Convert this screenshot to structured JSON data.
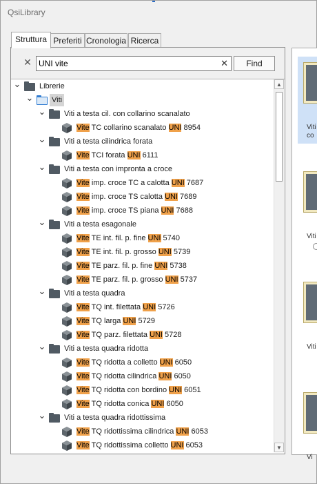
{
  "app": {
    "title": "QsiLibrary"
  },
  "tabs": [
    {
      "label": "Struttura",
      "active": true
    },
    {
      "label": "Preferiti",
      "active": false
    },
    {
      "label": "Cronologia",
      "active": false
    },
    {
      "label": "Ricerca",
      "active": false
    }
  ],
  "search": {
    "value": "UNI vite",
    "find_label": "Find"
  },
  "colors": {
    "highlight": "#f0a14a",
    "selected_row": "#d5d5d5",
    "folder": "#505a63",
    "folder_blue": "#2f7bd1"
  },
  "tree": [
    {
      "depth": 0,
      "type": "folder",
      "expanded": true,
      "parts": [
        {
          "t": "Librerie",
          "h": false
        }
      ]
    },
    {
      "depth": 1,
      "type": "folder-blue",
      "expanded": true,
      "selected": true,
      "parts": [
        {
          "t": "Viti",
          "h": false
        }
      ]
    },
    {
      "depth": 2,
      "type": "folder",
      "expanded": true,
      "parts": [
        {
          "t": "Viti a testa cil. con collarino scanalato",
          "h": false
        }
      ]
    },
    {
      "depth": 3,
      "type": "part",
      "parts": [
        {
          "t": "Vite",
          "h": true
        },
        {
          "t": " TC collarino scanalato ",
          "h": false
        },
        {
          "t": "UNI",
          "h": true
        },
        {
          "t": " 8954",
          "h": false
        }
      ]
    },
    {
      "depth": 2,
      "type": "folder",
      "expanded": true,
      "parts": [
        {
          "t": "Viti a testa cilindrica forata",
          "h": false
        }
      ]
    },
    {
      "depth": 3,
      "type": "part",
      "parts": [
        {
          "t": "Vite",
          "h": true
        },
        {
          "t": " TCI forata ",
          "h": false
        },
        {
          "t": "UNI",
          "h": true
        },
        {
          "t": " 6111",
          "h": false
        }
      ]
    },
    {
      "depth": 2,
      "type": "folder",
      "expanded": true,
      "parts": [
        {
          "t": "Viti a testa con impronta a croce",
          "h": false
        }
      ]
    },
    {
      "depth": 3,
      "type": "part",
      "parts": [
        {
          "t": "Vite",
          "h": true
        },
        {
          "t": " imp. croce TC a calotta ",
          "h": false
        },
        {
          "t": "UNI",
          "h": true
        },
        {
          "t": " 7687",
          "h": false
        }
      ]
    },
    {
      "depth": 3,
      "type": "part",
      "parts": [
        {
          "t": "Vite",
          "h": true
        },
        {
          "t": " imp. croce TS calotta ",
          "h": false
        },
        {
          "t": "UNI",
          "h": true
        },
        {
          "t": " 7689",
          "h": false
        }
      ]
    },
    {
      "depth": 3,
      "type": "part",
      "parts": [
        {
          "t": "Vite",
          "h": true
        },
        {
          "t": " imp. croce TS piana ",
          "h": false
        },
        {
          "t": "UNI",
          "h": true
        },
        {
          "t": " 7688",
          "h": false
        }
      ]
    },
    {
      "depth": 2,
      "type": "folder",
      "expanded": true,
      "parts": [
        {
          "t": "Viti a testa esagonale",
          "h": false
        }
      ]
    },
    {
      "depth": 3,
      "type": "part",
      "parts": [
        {
          "t": "Vite",
          "h": true
        },
        {
          "t": " TE int. fil. p. fine ",
          "h": false
        },
        {
          "t": "UNI",
          "h": true
        },
        {
          "t": " 5740",
          "h": false
        }
      ]
    },
    {
      "depth": 3,
      "type": "part",
      "parts": [
        {
          "t": "Vite",
          "h": true
        },
        {
          "t": " TE int. fil. p. grosso ",
          "h": false
        },
        {
          "t": "UNI",
          "h": true
        },
        {
          "t": " 5739",
          "h": false
        }
      ]
    },
    {
      "depth": 3,
      "type": "part",
      "parts": [
        {
          "t": "Vite",
          "h": true
        },
        {
          "t": " TE parz. fil. p. fine ",
          "h": false
        },
        {
          "t": "UNI",
          "h": true
        },
        {
          "t": " 5738",
          "h": false
        }
      ]
    },
    {
      "depth": 3,
      "type": "part",
      "parts": [
        {
          "t": "Vite",
          "h": true
        },
        {
          "t": " TE parz. fil. p. grosso ",
          "h": false
        },
        {
          "t": "UNI",
          "h": true
        },
        {
          "t": " 5737",
          "h": false
        }
      ]
    },
    {
      "depth": 2,
      "type": "folder",
      "expanded": true,
      "parts": [
        {
          "t": "Viti a testa quadra",
          "h": false
        }
      ]
    },
    {
      "depth": 3,
      "type": "part",
      "parts": [
        {
          "t": "Vite",
          "h": true
        },
        {
          "t": " TQ int. filettata ",
          "h": false
        },
        {
          "t": "UNI",
          "h": true
        },
        {
          "t": " 5726",
          "h": false
        }
      ]
    },
    {
      "depth": 3,
      "type": "part",
      "parts": [
        {
          "t": "Vite",
          "h": true
        },
        {
          "t": " TQ larga ",
          "h": false
        },
        {
          "t": "UNI",
          "h": true
        },
        {
          "t": " 5729",
          "h": false
        }
      ]
    },
    {
      "depth": 3,
      "type": "part",
      "parts": [
        {
          "t": "Vite",
          "h": true
        },
        {
          "t": " TQ parz. filettata ",
          "h": false
        },
        {
          "t": "UNI",
          "h": true
        },
        {
          "t": " 5728",
          "h": false
        }
      ]
    },
    {
      "depth": 2,
      "type": "folder",
      "expanded": true,
      "parts": [
        {
          "t": "Viti a testa quadra ridotta",
          "h": false
        }
      ]
    },
    {
      "depth": 3,
      "type": "part",
      "parts": [
        {
          "t": "Vite",
          "h": true
        },
        {
          "t": " TQ ridotta a colletto ",
          "h": false
        },
        {
          "t": "UNI",
          "h": true
        },
        {
          "t": " 6050",
          "h": false
        }
      ]
    },
    {
      "depth": 3,
      "type": "part",
      "parts": [
        {
          "t": "Vite",
          "h": true
        },
        {
          "t": " TQ ridotta cilindrica ",
          "h": false
        },
        {
          "t": "UNI",
          "h": true
        },
        {
          "t": " 6050",
          "h": false
        }
      ]
    },
    {
      "depth": 3,
      "type": "part",
      "parts": [
        {
          "t": "Vite",
          "h": true
        },
        {
          "t": " TQ ridotta con bordino ",
          "h": false
        },
        {
          "t": "UNI",
          "h": true
        },
        {
          "t": " 6051",
          "h": false
        }
      ]
    },
    {
      "depth": 3,
      "type": "part",
      "parts": [
        {
          "t": "Vite",
          "h": true
        },
        {
          "t": " TQ ridotta conica ",
          "h": false
        },
        {
          "t": "UNI",
          "h": true
        },
        {
          "t": " 6050",
          "h": false
        }
      ]
    },
    {
      "depth": 2,
      "type": "folder",
      "expanded": true,
      "parts": [
        {
          "t": "Viti a testa quadra ridottissima",
          "h": false
        }
      ]
    },
    {
      "depth": 3,
      "type": "part",
      "parts": [
        {
          "t": "Vite",
          "h": true
        },
        {
          "t": " TQ ridottissima cilindrica ",
          "h": false
        },
        {
          "t": "UNI",
          "h": true
        },
        {
          "t": " 6053",
          "h": false
        }
      ]
    },
    {
      "depth": 3,
      "type": "part",
      "parts": [
        {
          "t": "Vite",
          "h": true
        },
        {
          "t": " TQ ridottissima colletto ",
          "h": false
        },
        {
          "t": "UNI",
          "h": true
        },
        {
          "t": " 6053",
          "h": false
        }
      ]
    }
  ],
  "preview_cards": [
    {
      "line1": "Viti",
      "line2": "co",
      "selected": true
    },
    {
      "line1": "Viti",
      "line2": "",
      "selected": false
    },
    {
      "line1": "Viti",
      "line2": "",
      "selected": false
    },
    {
      "line1": "Vi",
      "line2": "",
      "selected": false
    }
  ]
}
